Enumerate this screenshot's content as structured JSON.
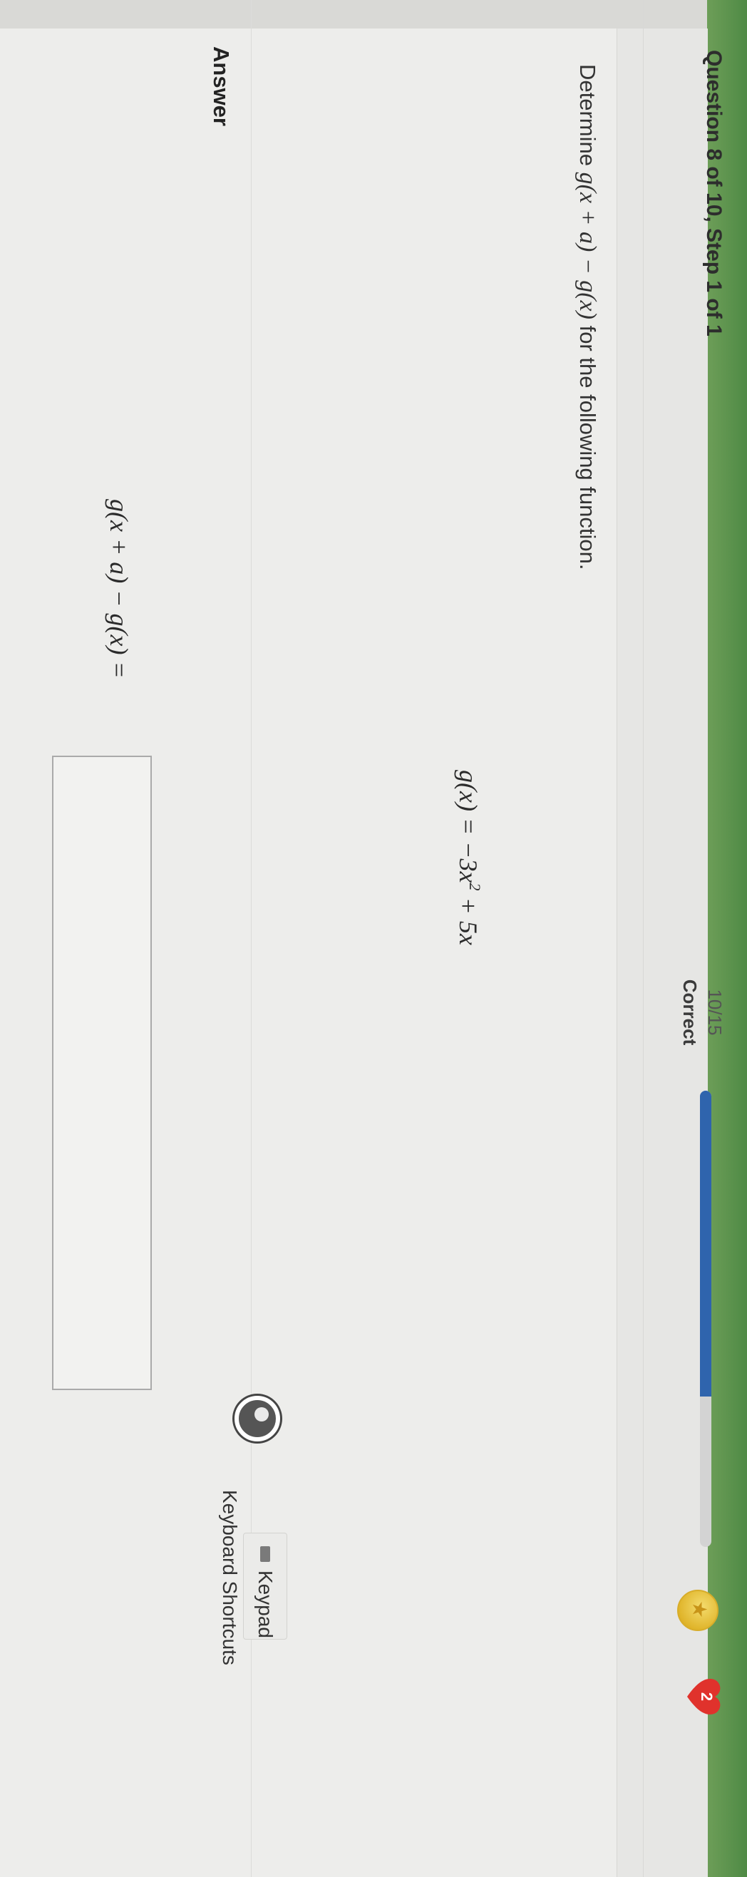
{
  "question": {
    "title": "Question 8 of 10, Step 1 of 1"
  },
  "score": {
    "value": "10/15",
    "label": "Correct",
    "progress_fraction": 0.67
  },
  "status": {
    "hearts": "2"
  },
  "prompt": {
    "text_before": "Determine ",
    "expression": "g(x + a) − g(x)",
    "text_after": " for the following function."
  },
  "function": {
    "lhs": "g(x) = −3x",
    "exponent": "2",
    "rhs": " + 5x"
  },
  "tools": {
    "keypad_label": "Keypad",
    "shortcuts_label": "Keyboard Shortcuts"
  },
  "answer": {
    "label": "Answer",
    "expression": "g(x + a) − g(x) =",
    "value": ""
  },
  "colors": {
    "progress_fill": "#2f64ad",
    "heart": "#e0322c",
    "coin": "#e0b52b",
    "side_strip": "#4f8a45"
  }
}
